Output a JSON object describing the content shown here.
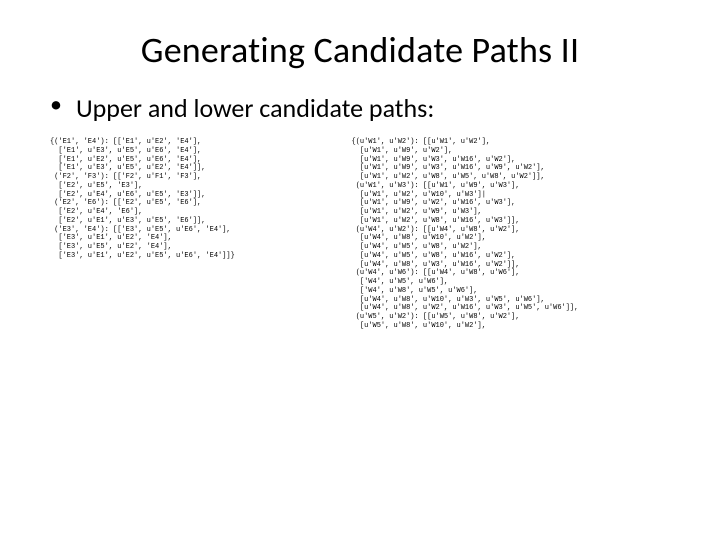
{
  "title": "Generating Candidate Paths II",
  "bullet": "Upper and lower candidate paths:",
  "code_left_lines": [
    "{('E1', 'E4'): [['E1', u'E2', 'E4'],",
    "  ['E1', u'E3', u'E5', u'E6', 'E4'],",
    "  ['E1', u'E2', u'E5', u'E6', 'E4'],",
    "  ['E1', u'E3', u'E5', u'E2', 'E4']],",
    " ('F2', 'F3'): [['F2', u'F1', 'F3'],",
    "  ['E2', u'E5', 'E3'],",
    "  ['E2', u'E4', u'E6', u'E5', 'E3']],",
    " ('E2', 'E6'): [['E2', u'E5', 'E6'],",
    "  ['E2', u'E4', 'E6'],",
    "  ['E2', u'E1', u'E3', u'E5', 'E6']],",
    " ('E3', 'E4'): [['E3', u'E5', u'E6', 'E4'],",
    "  ['E3', u'E1', u'E2', 'E4'],",
    "  ['E3', u'E5', u'E2', 'E4'],",
    "  ['E3', u'E1', u'E2', u'E5', u'E6', 'E4']]}"
  ],
  "code_right_lines": [
    "{(u'W1', u'W2'): [[u'W1', u'W2'],",
    "  [u'W1', u'W9', u'W2'],",
    "  [u'W1', u'W9', u'W3', u'W16', u'W2'],",
    "  [u'W1', u'W9', u'W3', u'W16', u'W9', u'W2'],",
    "  [u'W1', u'W2', u'W8', u'W5', u'W8', u'W2']],",
    " (u'W1', u'W3'): [[u'W1', u'W9', u'W3'],",
    "  [u'W1', u'W2', u'W10', u'W3']|",
    "  [u'W1', u'W9', u'W2', u'W16', u'W3'],",
    "  [u'W1', u'W2', u'W9', u'W3'],",
    "  [u'W1', u'W2', u'W8', u'W16', u'W3']],",
    " (u'W4', u'W2'): [[u'W4', u'W8', u'W2'],",
    "  [u'W4', u'W8', u'W10', u'W2'],",
    "  [u'W4', u'W5', u'W8', u'W2'],",
    "  [u'W4', u'W5', u'W8', u'W16', u'W2'],",
    "  [u'W4', u'W8', u'W3', u'W16', u'W2']],",
    " (u'W4', u'W6'): [[u'W4', u'W8', u'W6'],",
    "  ['W4', u'W5', u'W6'],",
    "  ['W4', u'W8', u'W5', u'W6'],",
    "  [u'W4', u'W8', u'W10', u'W3', u'W5', u'W6'],",
    "  [u'W4', u'W8', u'W2', u'W16', u'W3', u'W5', u'W6']],",
    " (u'W5', u'W2'): [[u'W5', u'W8', u'W2'],",
    "  [u'W5', u'W8', u'W10', u'W2'],"
  ]
}
